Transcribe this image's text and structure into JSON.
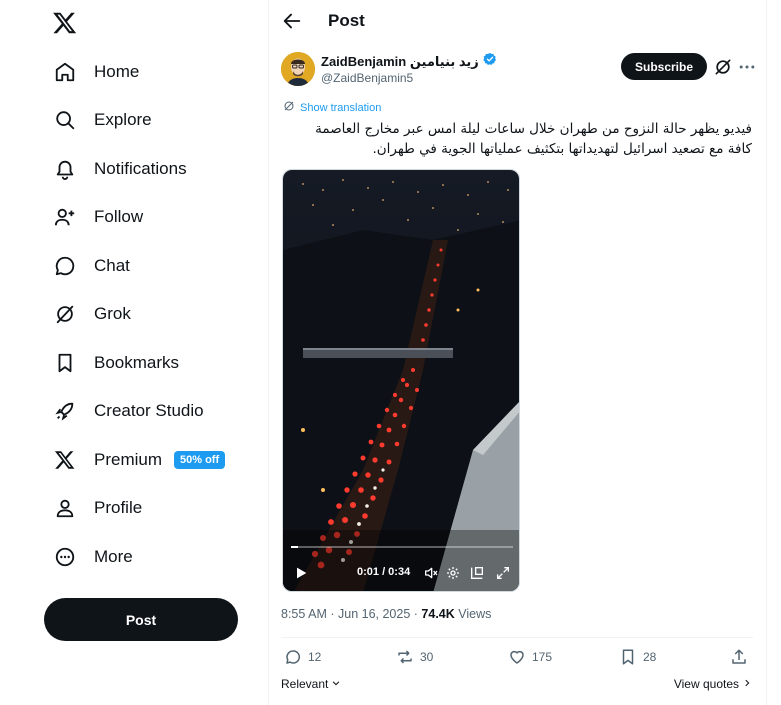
{
  "sidebar": {
    "logo": "x-logo",
    "items": [
      {
        "label": "Home",
        "icon": "home-icon"
      },
      {
        "label": "Explore",
        "icon": "search-icon"
      },
      {
        "label": "Notifications",
        "icon": "bell-icon"
      },
      {
        "label": "Follow",
        "icon": "person-add-icon"
      },
      {
        "label": "Chat",
        "icon": "chat-icon"
      },
      {
        "label": "Grok",
        "icon": "grok-icon"
      },
      {
        "label": "Bookmarks",
        "icon": "bookmark-icon"
      },
      {
        "label": "Creator Studio",
        "icon": "rocket-icon"
      },
      {
        "label": "Premium",
        "icon": "x-icon",
        "badge": "50% off"
      },
      {
        "label": "Profile",
        "icon": "person-icon"
      },
      {
        "label": "More",
        "icon": "more-circle-icon"
      }
    ],
    "post_label": "Post"
  },
  "header": {
    "title": "Post"
  },
  "tweet": {
    "display_name": "ZaidBenjamin زيد بنيامين",
    "handle": "@ZaidBenjamin5",
    "subscribe_label": "Subscribe",
    "show_translation": "Show translation",
    "text": "فيديو يظهر حالة النزوح من طهران خلال ساعات ليلة امس عبر مخارج العاصمة كافة مع تصعيد اسرائيل لتهديداتها بتكثيف عملياتها الجوية في طهران.",
    "video": {
      "timecode": "0:01 / 0:34",
      "progress": 0.03
    },
    "time": "8:55 AM",
    "date": "Jun 16, 2025",
    "views_count": "74.4K",
    "views_label": "Views",
    "stats": {
      "replies": "12",
      "reposts": "30",
      "likes": "175",
      "bookmarks": "28"
    },
    "sort_label": "Relevant",
    "view_quotes_label": "View quotes"
  },
  "colors": {
    "accent": "#1d9bf0",
    "text": "#0f1419",
    "muted": "#536471",
    "verified": "#1d9bf0"
  }
}
